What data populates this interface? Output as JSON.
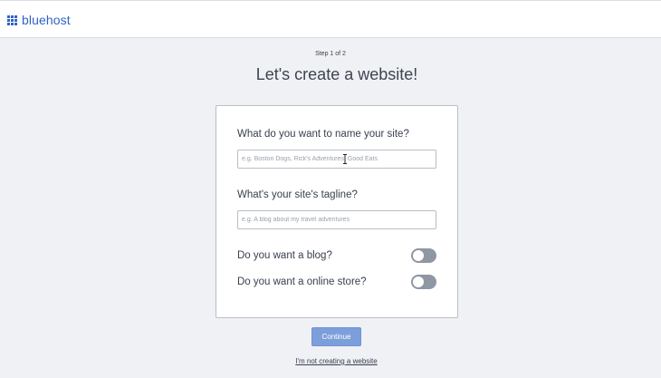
{
  "header": {
    "logo_text": "bluehost",
    "logo_icon": "grid-icon",
    "brand_color": "#2f63c7"
  },
  "page": {
    "step": "Step 1 of 2",
    "title": "Let's create a website!"
  },
  "form": {
    "site_name_label": "What do you want to name your site?",
    "site_name_placeholder": "e.g. Boston Dogs, Rick's Adventures, Good Eats",
    "site_name_value": "",
    "tagline_label": "What's your site's tagline?",
    "tagline_placeholder": "e.g. A blog about my travel adventures",
    "tagline_value": "",
    "blog_label": "Do you want a blog?",
    "blog_enabled": false,
    "store_label": "Do you want a online store?",
    "store_enabled": false
  },
  "actions": {
    "continue_label": "Continue",
    "continue_color": "#7c9fdb",
    "skip_label": "I'm not creating a website"
  }
}
